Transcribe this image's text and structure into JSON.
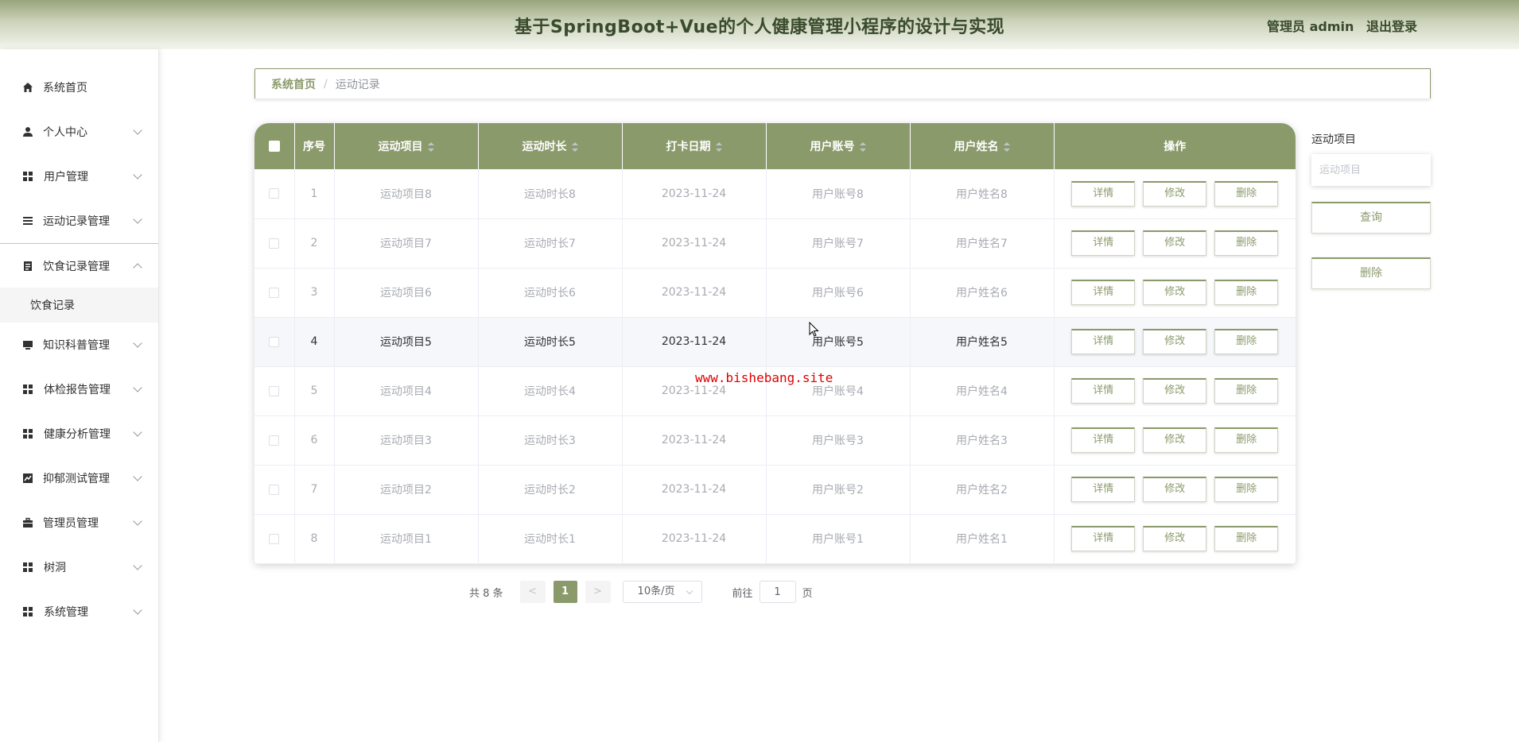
{
  "header": {
    "title": "基于SpringBoot+Vue的个人健康管理小程序的设计与实现",
    "user_label": "管理员 admin",
    "logout": "退出登录"
  },
  "sidebar": {
    "items": [
      {
        "label": "系统首页"
      },
      {
        "label": "个人中心"
      },
      {
        "label": "用户管理"
      },
      {
        "label": "运动记录管理"
      },
      {
        "label": "饮食记录管理"
      },
      {
        "label": "饮食记录"
      },
      {
        "label": "知识科普管理"
      },
      {
        "label": "体检报告管理"
      },
      {
        "label": "健康分析管理"
      },
      {
        "label": "抑郁测试管理"
      },
      {
        "label": "管理员管理"
      },
      {
        "label": "树洞"
      },
      {
        "label": "系统管理"
      }
    ]
  },
  "breadcrumb": {
    "home": "系统首页",
    "separator": "/",
    "current": "运动记录"
  },
  "table": {
    "columns": [
      "序号",
      "运动项目",
      "运动时长",
      "打卡日期",
      "用户账号",
      "用户姓名",
      "操作"
    ],
    "actions": {
      "detail": "详情",
      "edit": "修改",
      "delete": "删除"
    },
    "rows": [
      {
        "index": "1",
        "item": "运动项目8",
        "duration": "运动时长8",
        "date": "2023-11-24",
        "account": "用户账号8",
        "name": "用户姓名8"
      },
      {
        "index": "2",
        "item": "运动项目7",
        "duration": "运动时长7",
        "date": "2023-11-24",
        "account": "用户账号7",
        "name": "用户姓名7"
      },
      {
        "index": "3",
        "item": "运动项目6",
        "duration": "运动时长6",
        "date": "2023-11-24",
        "account": "用户账号6",
        "name": "用户姓名6"
      },
      {
        "index": "4",
        "item": "运动项目5",
        "duration": "运动时长5",
        "date": "2023-11-24",
        "account": "用户账号5",
        "name": "用户姓名5"
      },
      {
        "index": "5",
        "item": "运动项目4",
        "duration": "运动时长4",
        "date": "2023-11-24",
        "account": "用户账号4",
        "name": "用户姓名4"
      },
      {
        "index": "6",
        "item": "运动项目3",
        "duration": "运动时长3",
        "date": "2023-11-24",
        "account": "用户账号3",
        "name": "用户姓名3"
      },
      {
        "index": "7",
        "item": "运动项目2",
        "duration": "运动时长2",
        "date": "2023-11-24",
        "account": "用户账号2",
        "name": "用户姓名2"
      },
      {
        "index": "8",
        "item": "运动项目1",
        "duration": "运动时长1",
        "date": "2023-11-24",
        "account": "用户账号1",
        "name": "用户姓名1"
      }
    ]
  },
  "search_panel": {
    "label": "运动项目",
    "placeholder": "运动项目",
    "search_button": "查询",
    "delete_button": "删除"
  },
  "pagination": {
    "total": "共 8 条",
    "prev": "<",
    "current_page": "1",
    "next": ">",
    "page_size": "10条/页",
    "goto_prefix": "前往",
    "goto_value": "1",
    "goto_suffix": "页"
  },
  "watermark": "www.bishebang.site",
  "colors": {
    "accent": "#8b9a6b",
    "header_dark": "#3a4a2c"
  }
}
